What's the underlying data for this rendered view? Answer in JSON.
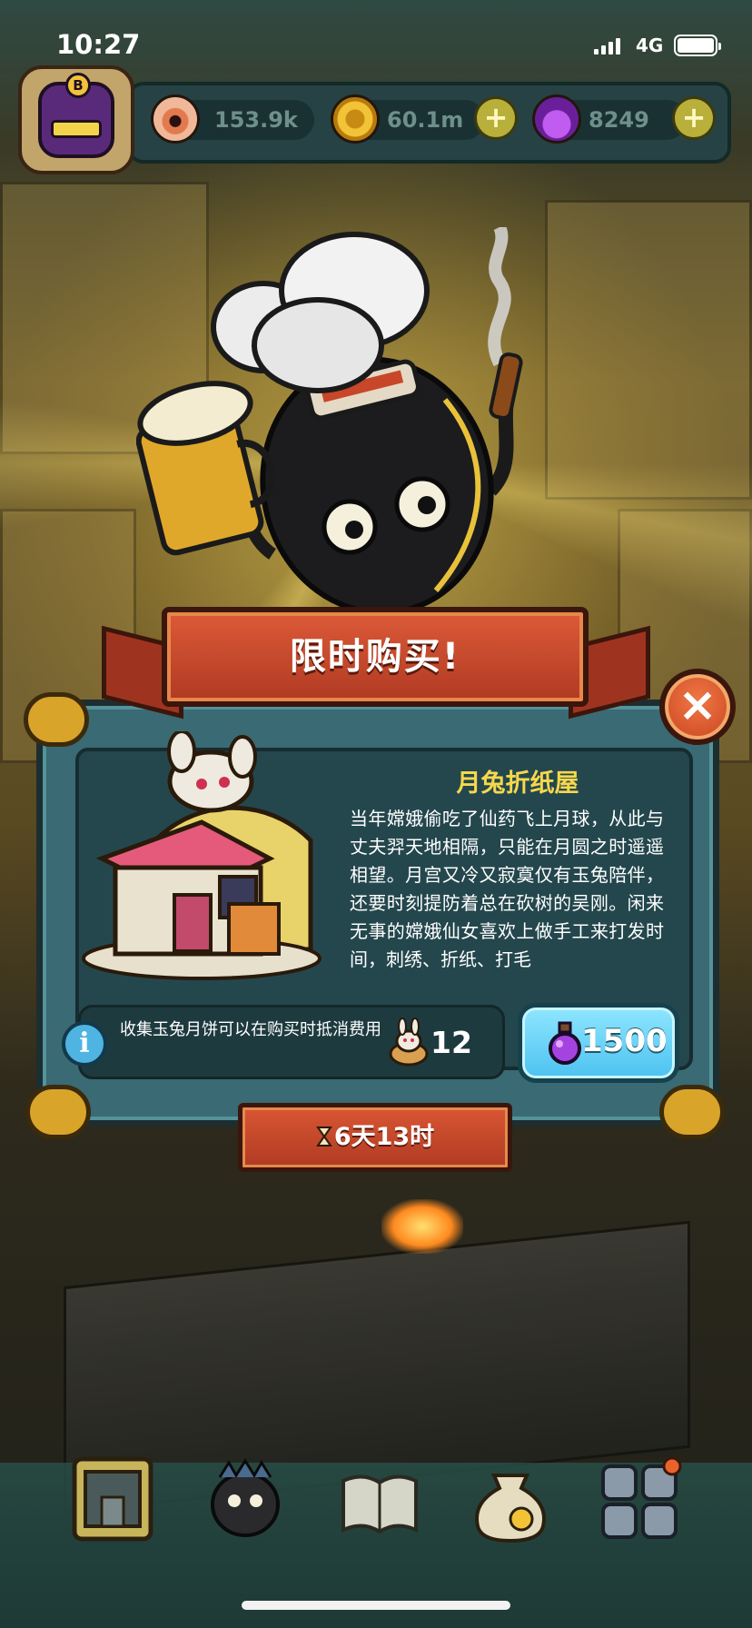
{
  "status_bar": {
    "time": "10:27",
    "network": "4G"
  },
  "resources": {
    "eyes": "153.9k",
    "coins": "60.1m",
    "potions": "8249"
  },
  "offer": {
    "title": "限时购买!",
    "item_name": "月兔折纸屋",
    "description": "当年嫦娥偷吃了仙药飞上月球，从此与丈夫羿天地相隔，只能在月圆之时遥遥相望。月宫又冷又寂寞仅有玉兔陪伴，还要时刻提防着总在砍树的吴刚。闲来无事的嫦娥仙女喜欢上做手工来打发时间，刺绣、折纸、打毛",
    "info_text": "收集玉兔月饼可以在购买时抵消费用",
    "mooncake_count": "12",
    "price": "1500",
    "timer": "6天13时"
  },
  "bottom_nav": {
    "items": [
      "building",
      "monster",
      "book",
      "money-bag",
      "grid"
    ]
  },
  "colors": {
    "ribbon": "#c8462a",
    "panel": "#3a6a73",
    "item_name": "#f7d84c",
    "buy_button": "#6fd6f8"
  }
}
